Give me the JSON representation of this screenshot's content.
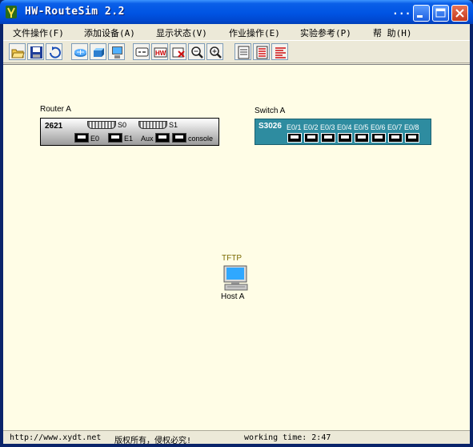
{
  "app": {
    "title": "HW-RouteSim 2.2",
    "title_dots": "..."
  },
  "menu": [
    {
      "label": "文件操作(F)"
    },
    {
      "label": "添加设备(A)"
    },
    {
      "label": "显示状态(V)"
    },
    {
      "label": "作业操作(E)"
    },
    {
      "label": "实验参考(P)"
    },
    {
      "label": "帮 助(H)"
    }
  ],
  "toolbar_icons": [
    "open-folder-icon",
    "save-icon",
    "refresh-icon",
    "router-icon",
    "switch-icon",
    "host-icon",
    "console-icon",
    "hw-icon",
    "delete-icon",
    "zoom-out-icon",
    "zoom-in-icon",
    "document-icon",
    "list-red-icon",
    "list-lines-icon"
  ],
  "router": {
    "label": "Router A",
    "model": "2621",
    "ports": {
      "s0": "S0",
      "s1": "S1",
      "e0": "E0",
      "e1": "E1",
      "aux": "Aux",
      "console": "console"
    }
  },
  "switch": {
    "label": "Switch A",
    "model": "S3026",
    "ports": [
      "E0/1",
      "E0/2",
      "E0/3",
      "E0/4",
      "E0/5",
      "E0/6",
      "E0/7",
      "E0/8"
    ]
  },
  "host": {
    "tag": "TFTP",
    "label": "Host A"
  },
  "status": {
    "url": "http://www.xydt.net",
    "copyright": "版权所有，侵权必究!",
    "working_time": "working time: 2:47"
  },
  "colors": {
    "canvas": "#fffde6",
    "switch": "#2e8ca0",
    "titlebar": "#0054e3"
  }
}
